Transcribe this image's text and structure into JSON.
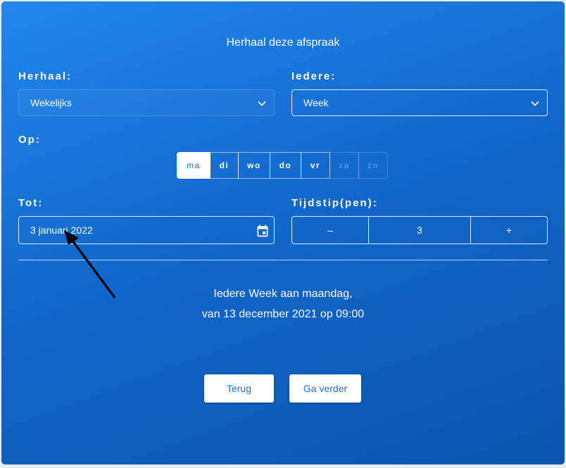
{
  "dialog": {
    "title": "Herhaal deze afspraak"
  },
  "repeat": {
    "label": "Herhaal:",
    "value": "Wekelijks"
  },
  "every": {
    "label": "Iedere:",
    "value": "Week"
  },
  "on": {
    "label": "Op:",
    "days": [
      {
        "label": "ma",
        "state": "selected"
      },
      {
        "label": "di",
        "state": "enabled"
      },
      {
        "label": "wo",
        "state": "enabled"
      },
      {
        "label": "do",
        "state": "enabled"
      },
      {
        "label": "vr",
        "state": "enabled"
      },
      {
        "label": "za",
        "state": "disabled"
      },
      {
        "label": "zo",
        "state": "disabled"
      }
    ]
  },
  "until": {
    "label": "Tot:",
    "value": "3 januari 2022"
  },
  "occurrences": {
    "label": "Tijdstip(pen):",
    "minus": "–",
    "value": "3",
    "plus": "+"
  },
  "summary": {
    "line1": "Iedere Week aan maandag,",
    "line2": "van 13 december 2021 op 09:00"
  },
  "buttons": {
    "back": "Terug",
    "next": "Ga verder"
  },
  "colors": {
    "panel_gradient_start": "#2287ec",
    "panel_gradient_end": "#0a55ad",
    "button_text": "#1e74d6"
  }
}
